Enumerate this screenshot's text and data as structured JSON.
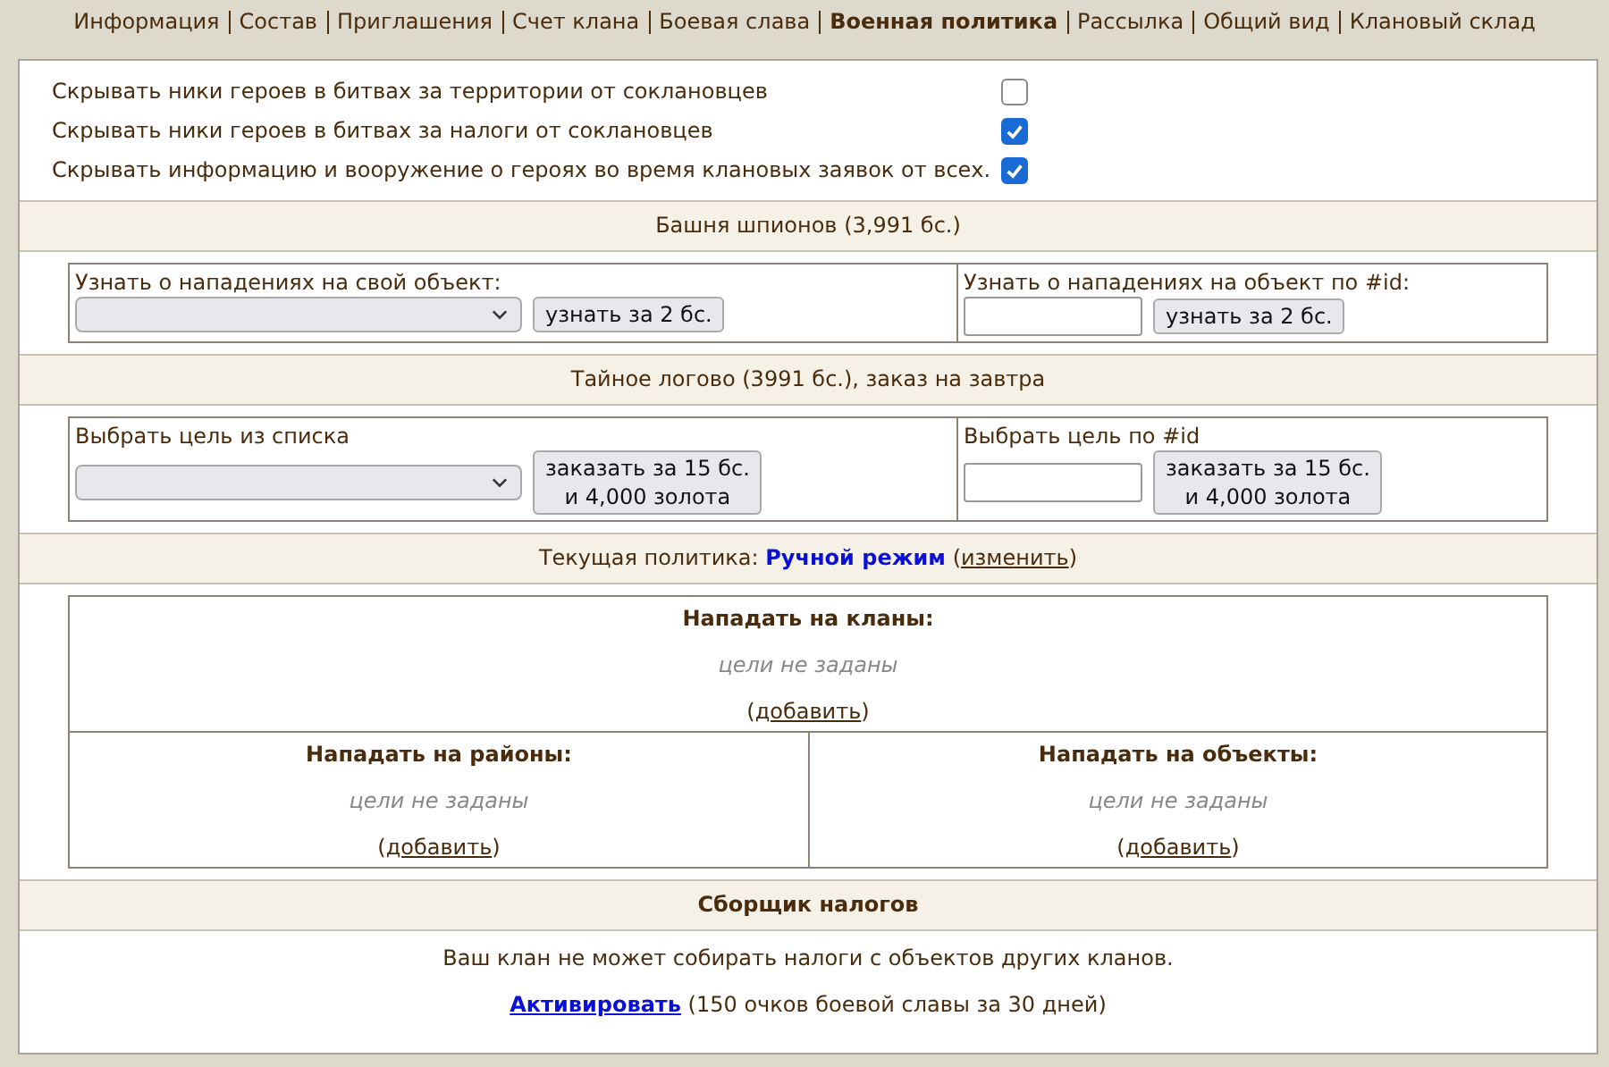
{
  "nav": [
    {
      "label": "Информация",
      "selected": false
    },
    {
      "label": "Состав",
      "selected": false
    },
    {
      "label": "Приглашения",
      "selected": false
    },
    {
      "label": "Счет клана",
      "selected": false
    },
    {
      "label": "Боевая слава",
      "selected": false
    },
    {
      "label": "Военная политика",
      "selected": true
    },
    {
      "label": "Рассылка",
      "selected": false
    },
    {
      "label": "Общий вид",
      "selected": false
    },
    {
      "label": "Клановый склад",
      "selected": false
    }
  ],
  "settings": [
    {
      "label": "Скрывать ники героев в битвах за территории от соклановцев",
      "checked": false
    },
    {
      "label": "Скрывать ники героев в битвах за налоги от соклановцев",
      "checked": true
    },
    {
      "label": "Скрывать информацию и вооружение о героях во время клановых заявок от всех.",
      "checked": true
    }
  ],
  "spy_tower": {
    "title": "Башня шпионов (3,991 бс.)",
    "left": {
      "label": "Узнать о нападениях на свой объект:",
      "kind": "select",
      "button": [
        "узнать за 2 бс."
      ]
    },
    "right": {
      "label": "Узнать о нападениях на объект по #id:",
      "kind": "input",
      "button": [
        "узнать за 2 бс."
      ]
    }
  },
  "lair": {
    "title": "Тайное логово (3991 бс.), заказ на завтра",
    "left": {
      "label": "Выбрать цель из списка",
      "kind": "select",
      "button": [
        "заказать за 15 бс.",
        "и 4,000 золота"
      ]
    },
    "right": {
      "label": "Выбрать цель по #id",
      "kind": "input",
      "button": [
        "заказать за 15 бс.",
        "и 4,000 золота"
      ]
    }
  },
  "policy": {
    "label": "Текущая политика:",
    "mode": "Ручной режим",
    "before": "(",
    "link": "изменить",
    "after": ")"
  },
  "targets": [
    {
      "kind": "wide",
      "title": "Нападать на кланы:",
      "empty": "цели не заданы",
      "before": "(",
      "link": "добавить",
      "after": ")"
    },
    {
      "kind": "half",
      "title": "Нападать на районы:",
      "empty": "цели не заданы",
      "before": "(",
      "link": "добавить",
      "after": ")"
    },
    {
      "kind": "half",
      "title": "Нападать на объекты:",
      "empty": "цели не заданы",
      "before": "(",
      "link": "добавить",
      "after": ")"
    }
  ],
  "tax": {
    "title": "Сборщик налогов",
    "text": "Ваш клан не может собирать налоги с объектов других кланов.",
    "link": "Активировать",
    "after": " (150 очков боевой славы за 30 дней)"
  }
}
